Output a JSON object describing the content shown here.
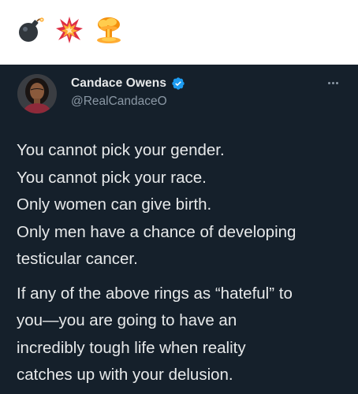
{
  "emojis": [
    "bomb",
    "collision",
    "mushroom-cloud"
  ],
  "tweet": {
    "author_name": "Candace Owens",
    "author_handle": "@RealCandaceO",
    "verified": true,
    "paragraphs": [
      [
        "You cannot pick your gender.",
        "You cannot pick your race.",
        "Only women can give birth.",
        "Only men have a chance of developing",
        "testicular cancer."
      ],
      [
        "If any of the above rings as “hateful” to",
        "you—you are going to have an",
        "incredibly tough life when reality",
        "catches up with your delusion."
      ]
    ]
  },
  "colors": {
    "tweet_background": "#15202b",
    "primary_text": "#e7e9ea",
    "secondary_text": "#8b98a5",
    "verified_badge": "#1d9bf0"
  }
}
